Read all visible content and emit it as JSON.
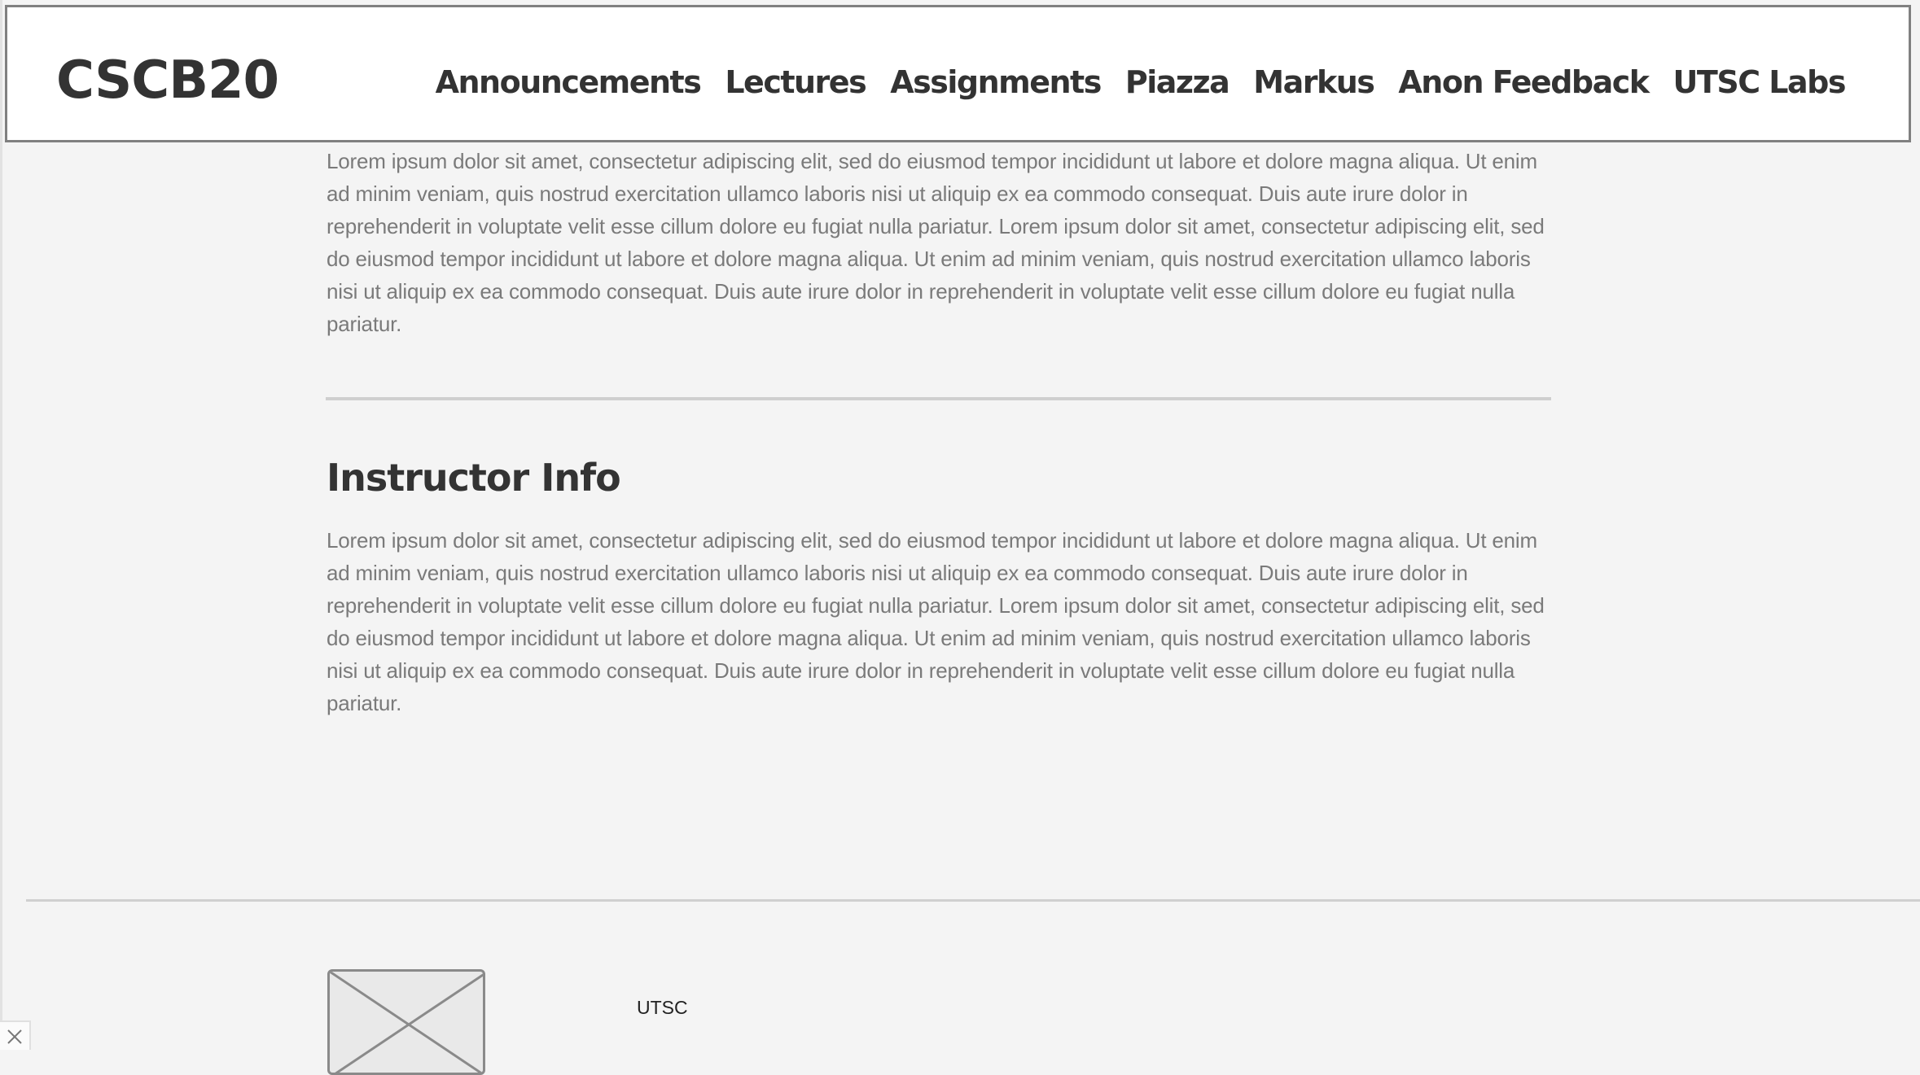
{
  "header": {
    "logo": "CSCB20",
    "nav": [
      {
        "label": "Announcements"
      },
      {
        "label": "Lectures"
      },
      {
        "label": "Assignments"
      },
      {
        "label": "Piazza"
      },
      {
        "label": "Markus"
      },
      {
        "label": "Anon Feedback"
      },
      {
        "label": "UTSC Labs"
      }
    ]
  },
  "main": {
    "intro_paragraph": "Lorem ipsum dolor sit amet, consectetur adipiscing elit, sed do eiusmod tempor incididunt ut labore et dolore magna aliqua. Ut enim ad minim veniam, quis nostrud exercitation ullamco laboris nisi ut aliquip ex ea commodo consequat. Duis aute irure dolor in reprehenderit in voluptate velit esse cillum dolore eu fugiat nulla pariatur. Lorem ipsum dolor sit amet, consectetur adipiscing elit, sed do eiusmod tempor incididunt ut labore et dolore magna aliqua. Ut enim ad minim veniam, quis nostrud exercitation ullamco laboris nisi ut aliquip ex ea commodo consequat. Duis aute irure dolor in reprehenderit in voluptate velit esse cillum dolore eu fugiat nulla pariatur.",
    "instructor_title": "Instructor Info",
    "instructor_paragraph": "Lorem ipsum dolor sit amet, consectetur adipiscing elit, sed do eiusmod tempor incididunt ut labore et dolore magna aliqua. Ut enim ad minim veniam, quis nostrud exercitation ullamco laboris nisi ut aliquip ex ea commodo consequat. Duis aute irure dolor in reprehenderit in voluptate velit esse cillum dolore eu fugiat nulla pariatur. Lorem ipsum dolor sit amet, consectetur adipiscing elit, sed do eiusmod tempor incididunt ut labore et dolore magna aliqua. Ut enim ad minim veniam, quis nostrud exercitation ullamco laboris nisi ut aliquip ex ea commodo consequat. Duis aute irure dolor in reprehenderit in voluptate velit esse cillum dolore eu fugiat nulla pariatur."
  },
  "footer": {
    "label": "UTSC",
    "image_icon": "image-placeholder-icon"
  },
  "widgets": {
    "close_icon": "close-icon"
  },
  "colors": {
    "background": "#f4f4f4",
    "header_bg": "#ffffff",
    "header_border": "#808080",
    "text_dark": "#333333",
    "text_muted": "#7a7a7a",
    "divider": "#cfcfcf"
  }
}
